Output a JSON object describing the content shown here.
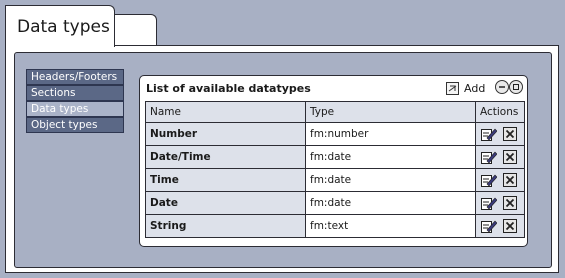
{
  "tab": {
    "title": "Data types"
  },
  "menu": {
    "items": [
      {
        "label": "Headers/Footers",
        "active": false
      },
      {
        "label": "Sections",
        "active": false
      },
      {
        "label": "Data types",
        "active": true
      },
      {
        "label": "Object types",
        "active": false
      }
    ]
  },
  "list": {
    "title": "List of available datatypes",
    "add_label": "Add",
    "columns": {
      "name": "Name",
      "type": "Type",
      "actions": "Actions"
    },
    "rows": [
      {
        "name": "Number",
        "type": "fm:number"
      },
      {
        "name": "Date/Time",
        "type": "fm:date"
      },
      {
        "name": "Time",
        "type": "fm:date"
      },
      {
        "name": "Date",
        "type": "fm:date"
      },
      {
        "name": "String",
        "type": "fm:text"
      }
    ]
  },
  "icons": {
    "add": "add-icon",
    "collapse": "minus-circle-icon",
    "expand": "square-circle-icon",
    "edit": "edit-pencil-icon",
    "delete": "delete-x-icon"
  },
  "colors": {
    "background": "#a8b0c4",
    "menu_item": "#5b6886",
    "menu_item_active": "#aab3c8",
    "table_header": "#dde1ea"
  }
}
